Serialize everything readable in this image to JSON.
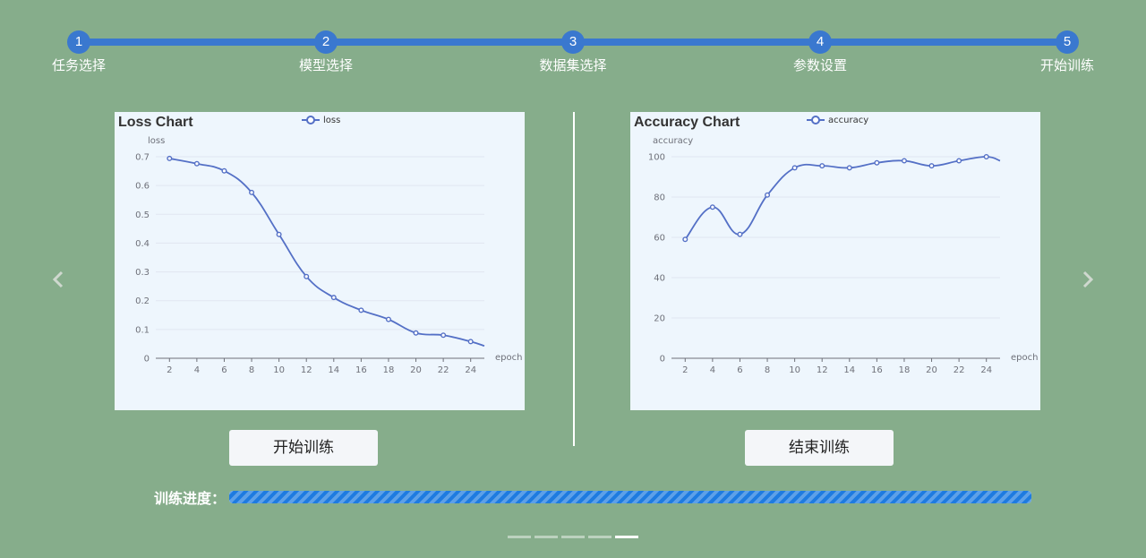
{
  "steps": [
    {
      "num": "1",
      "label": "任务选择"
    },
    {
      "num": "2",
      "label": "模型选择"
    },
    {
      "num": "3",
      "label": "数据集选择"
    },
    {
      "num": "4",
      "label": "参数设置"
    },
    {
      "num": "5",
      "label": "开始训练"
    }
  ],
  "colors": {
    "background": "#86ad8b",
    "accent": "#3a78cf",
    "series": "#5470c6",
    "progress": "#1e7be0"
  },
  "nav": {
    "prev_icon": "chevron-left-icon",
    "next_icon": "chevron-right-icon"
  },
  "chart_data": [
    {
      "type": "line",
      "title": "Loss Chart",
      "xlabel": "epoch",
      "ylabel": "loss",
      "legend": "top-center",
      "grid": true,
      "xlim": [
        1,
        25
      ],
      "ylim": [
        0,
        0.7
      ],
      "x_ticks": [
        2,
        4,
        6,
        8,
        10,
        12,
        14,
        16,
        18,
        20,
        22,
        24
      ],
      "y_ticks": [
        "0",
        "0.1",
        "0.2",
        "0.3",
        "0.4",
        "0.5",
        "0.6",
        "0.7"
      ],
      "series": [
        {
          "name": "loss",
          "x": [
            2,
            4,
            6,
            8,
            10,
            12,
            14,
            16,
            18,
            20,
            22,
            24,
            25
          ],
          "y": [
            0.694,
            0.676,
            0.651,
            0.576,
            0.43,
            0.284,
            0.211,
            0.167,
            0.135,
            0.088,
            0.08,
            0.058,
            0.043
          ]
        }
      ]
    },
    {
      "type": "line",
      "title": "Accuracy Chart",
      "xlabel": "epoch",
      "ylabel": "accuracy",
      "legend": "top-center",
      "grid": true,
      "xlim": [
        1,
        25
      ],
      "ylim": [
        0,
        100
      ],
      "x_ticks": [
        2,
        4,
        6,
        8,
        10,
        12,
        14,
        16,
        18,
        20,
        22,
        24
      ],
      "y_ticks": [
        "0",
        "20",
        "40",
        "60",
        "80",
        "100"
      ],
      "series": [
        {
          "name": "accuracy",
          "x": [
            2,
            4,
            6,
            8,
            10,
            12,
            14,
            16,
            18,
            20,
            22,
            24,
            25
          ],
          "y": [
            59,
            75,
            61.5,
            81,
            94.5,
            95.5,
            94.5,
            97,
            98,
            95.5,
            98,
            100,
            98
          ]
        }
      ]
    }
  ],
  "buttons": {
    "start": "开始训练",
    "stop": "结束训练"
  },
  "progress": {
    "label": "训练进度：",
    "value": 1.0
  },
  "pagination": {
    "count": 5,
    "active": 4
  }
}
